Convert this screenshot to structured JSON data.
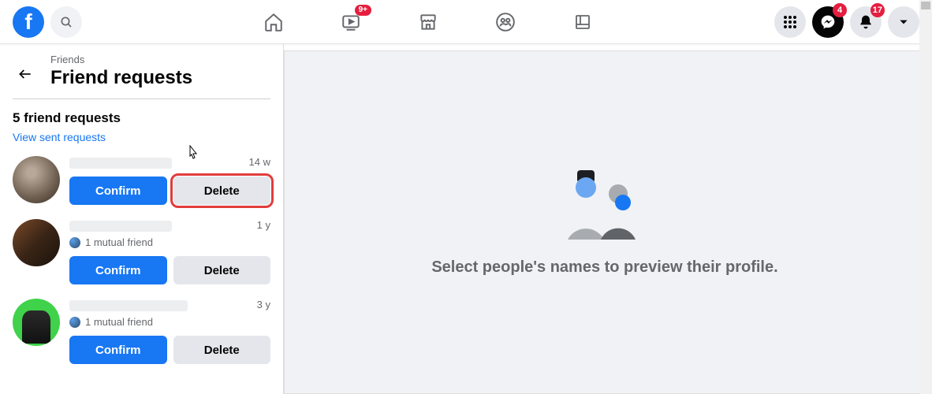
{
  "topbar": {
    "watch_badge": "9+",
    "messenger_badge": "4",
    "notifications_badge": "17"
  },
  "sidebar": {
    "breadcrumb": "Friends",
    "title": "Friend requests",
    "count_label": "5 friend requests",
    "sent_link": "View sent requests"
  },
  "requests": [
    {
      "time": "14 w",
      "mutual": null,
      "confirm": "Confirm",
      "delete": "Delete",
      "highlight_delete": true
    },
    {
      "time": "1 y",
      "mutual": "1 mutual friend",
      "confirm": "Confirm",
      "delete": "Delete",
      "highlight_delete": false
    },
    {
      "time": "3 y",
      "mutual": "1 mutual friend",
      "confirm": "Confirm",
      "delete": "Delete",
      "highlight_delete": false
    }
  ],
  "content": {
    "empty_text": "Select people's names to preview their profile."
  }
}
